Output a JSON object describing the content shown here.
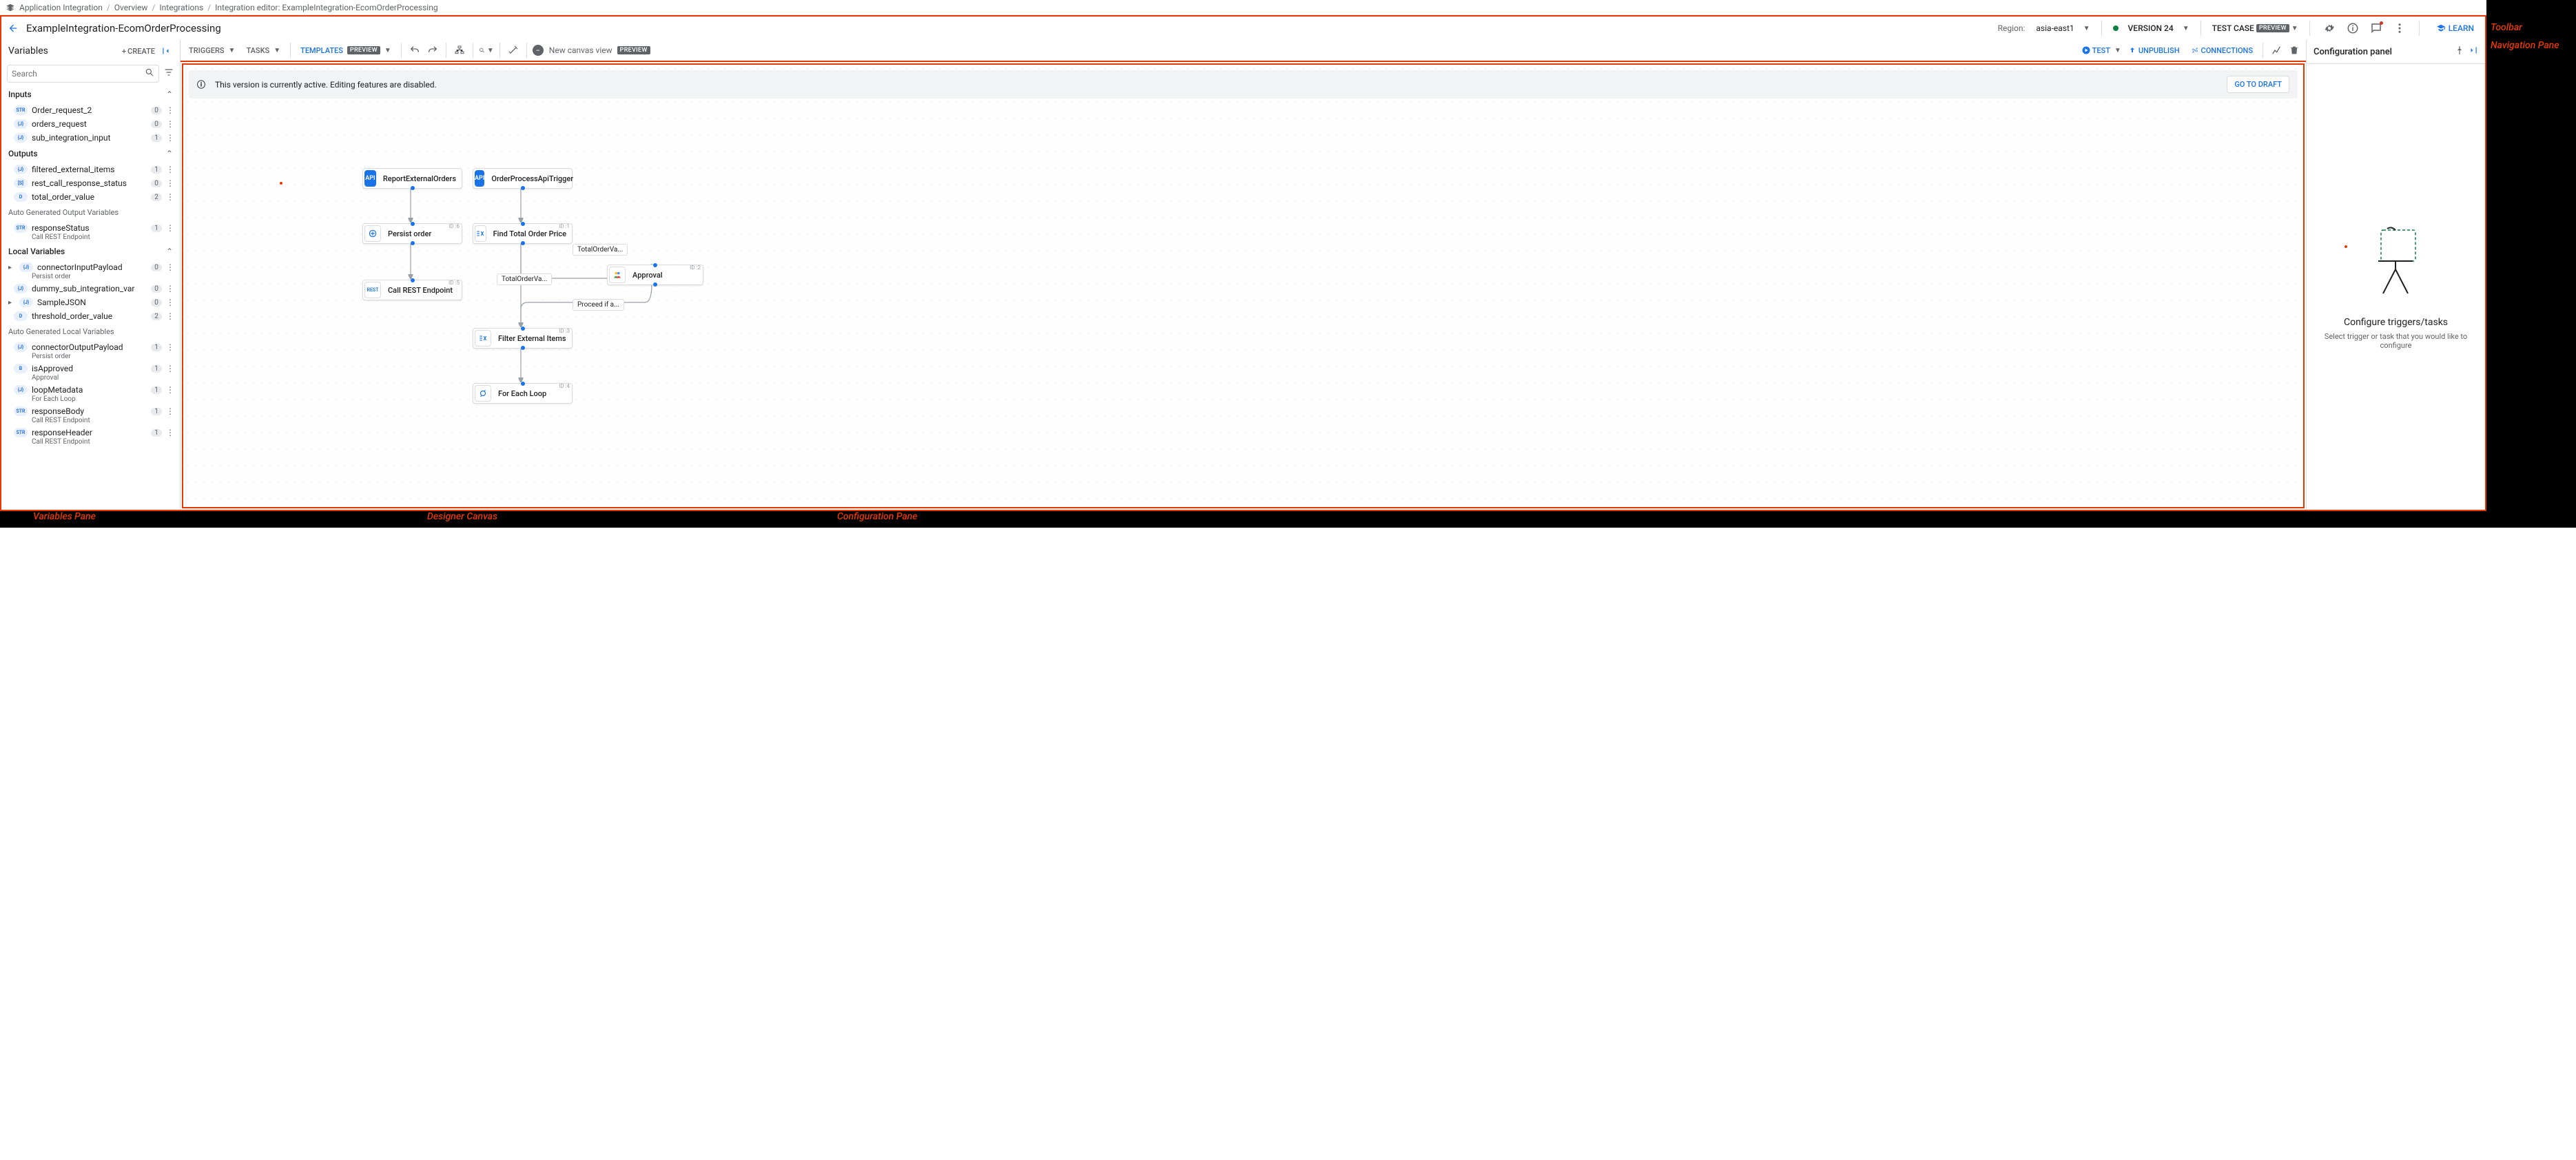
{
  "breadcrumb": {
    "items": [
      "Application Integration",
      "Overview",
      "Integrations",
      "Integration editor: ExampleIntegration-EcomOrderProcessing"
    ]
  },
  "header": {
    "title": "ExampleIntegration-EcomOrderProcessing",
    "region_label": "Region:",
    "region": "asia-east1",
    "version": "VERSION 24",
    "testcase": "TEST CASE",
    "preview": "PREVIEW",
    "learn": "LEARN"
  },
  "vars": {
    "title": "Variables",
    "create": "CREATE",
    "search_placeholder": "Search",
    "sections": {
      "inputs": "Inputs",
      "outputs": "Outputs",
      "auto_out": "Auto Generated Output Variables",
      "local": "Local Variables",
      "auto_local": "Auto Generated Local Variables"
    },
    "inputs": [
      {
        "type": "STR",
        "name": "Order_request_2",
        "count": "0"
      },
      {
        "type": "{J}",
        "name": "orders_request",
        "count": "0"
      },
      {
        "type": "{J}",
        "name": "sub_integration_input",
        "count": "1"
      }
    ],
    "outputs": [
      {
        "type": "{J}",
        "name": "filtered_external_items",
        "count": "1"
      },
      {
        "type": "[S]",
        "name": "rest_call_response_status",
        "count": "0"
      },
      {
        "type": "D",
        "name": "total_order_value",
        "count": "2"
      }
    ],
    "auto_out": [
      {
        "type": "STR",
        "name": "responseStatus",
        "sub": "Call REST Endpoint",
        "count": "1"
      }
    ],
    "local": [
      {
        "type": "{J}",
        "name": "connectorInputPayload",
        "sub": "Persist order",
        "count": "0",
        "exp": true
      },
      {
        "type": "{J}",
        "name": "dummy_sub_integration_var",
        "count": "0"
      },
      {
        "type": "{J}",
        "name": "SampleJSON",
        "count": "0",
        "exp": true
      },
      {
        "type": "D",
        "name": "threshold_order_value",
        "count": "2"
      }
    ],
    "auto_local": [
      {
        "type": "{J}",
        "name": "connectorOutputPayload",
        "sub": "Persist order",
        "count": "1"
      },
      {
        "type": "B",
        "name": "isApproved",
        "sub": "Approval",
        "count": "1"
      },
      {
        "type": "{J}",
        "name": "loopMetadata",
        "sub": "For Each Loop",
        "count": "1"
      },
      {
        "type": "STR",
        "name": "responseBody",
        "sub": "Call REST Endpoint",
        "count": "1"
      },
      {
        "type": "STR",
        "name": "responseHeader",
        "sub": "Call REST Endpoint",
        "count": "1"
      }
    ]
  },
  "toolbar": {
    "triggers": "TRIGGERS",
    "tasks": "TASKS",
    "templates": "TEMPLATES",
    "canvas_view": "New canvas view",
    "preview": "PREVIEW",
    "test": "TEST",
    "unpublish": "UNPUBLISH",
    "connections": "CONNECTIONS"
  },
  "banner": {
    "text": "This version is currently active. Editing features are disabled.",
    "draft": "GO TO DRAFT"
  },
  "nodes": {
    "n1": {
      "label": "ReportExternalOrders"
    },
    "n2": {
      "label": "OrderProcessApiTrigger"
    },
    "n3": {
      "label": "Persist order",
      "id": "ID :6"
    },
    "n4": {
      "label": "Find Total Order Price",
      "id": "ID :1"
    },
    "n5": {
      "label": "Call REST Endpoint",
      "id": "ID :5"
    },
    "n6": {
      "label": "Approval",
      "id": "ID :2"
    },
    "n7": {
      "label": "Filter External Items",
      "id": "ID :3"
    },
    "n8": {
      "label": "For Each Loop",
      "id": "ID :4"
    },
    "e1": "TotalOrderVa...",
    "e2": "TotalOrderVa...",
    "e3": "Proceed if a..."
  },
  "config": {
    "title": "Configuration panel",
    "heading": "Configure triggers/tasks",
    "subtext": "Select trigger or task that you would like to configure"
  },
  "annot": {
    "toolbar": "Toolbar",
    "nav": "Navigation Pane",
    "vars": "Variables Pane",
    "canvas": "Designer Canvas",
    "config": "Configuration Pane"
  }
}
